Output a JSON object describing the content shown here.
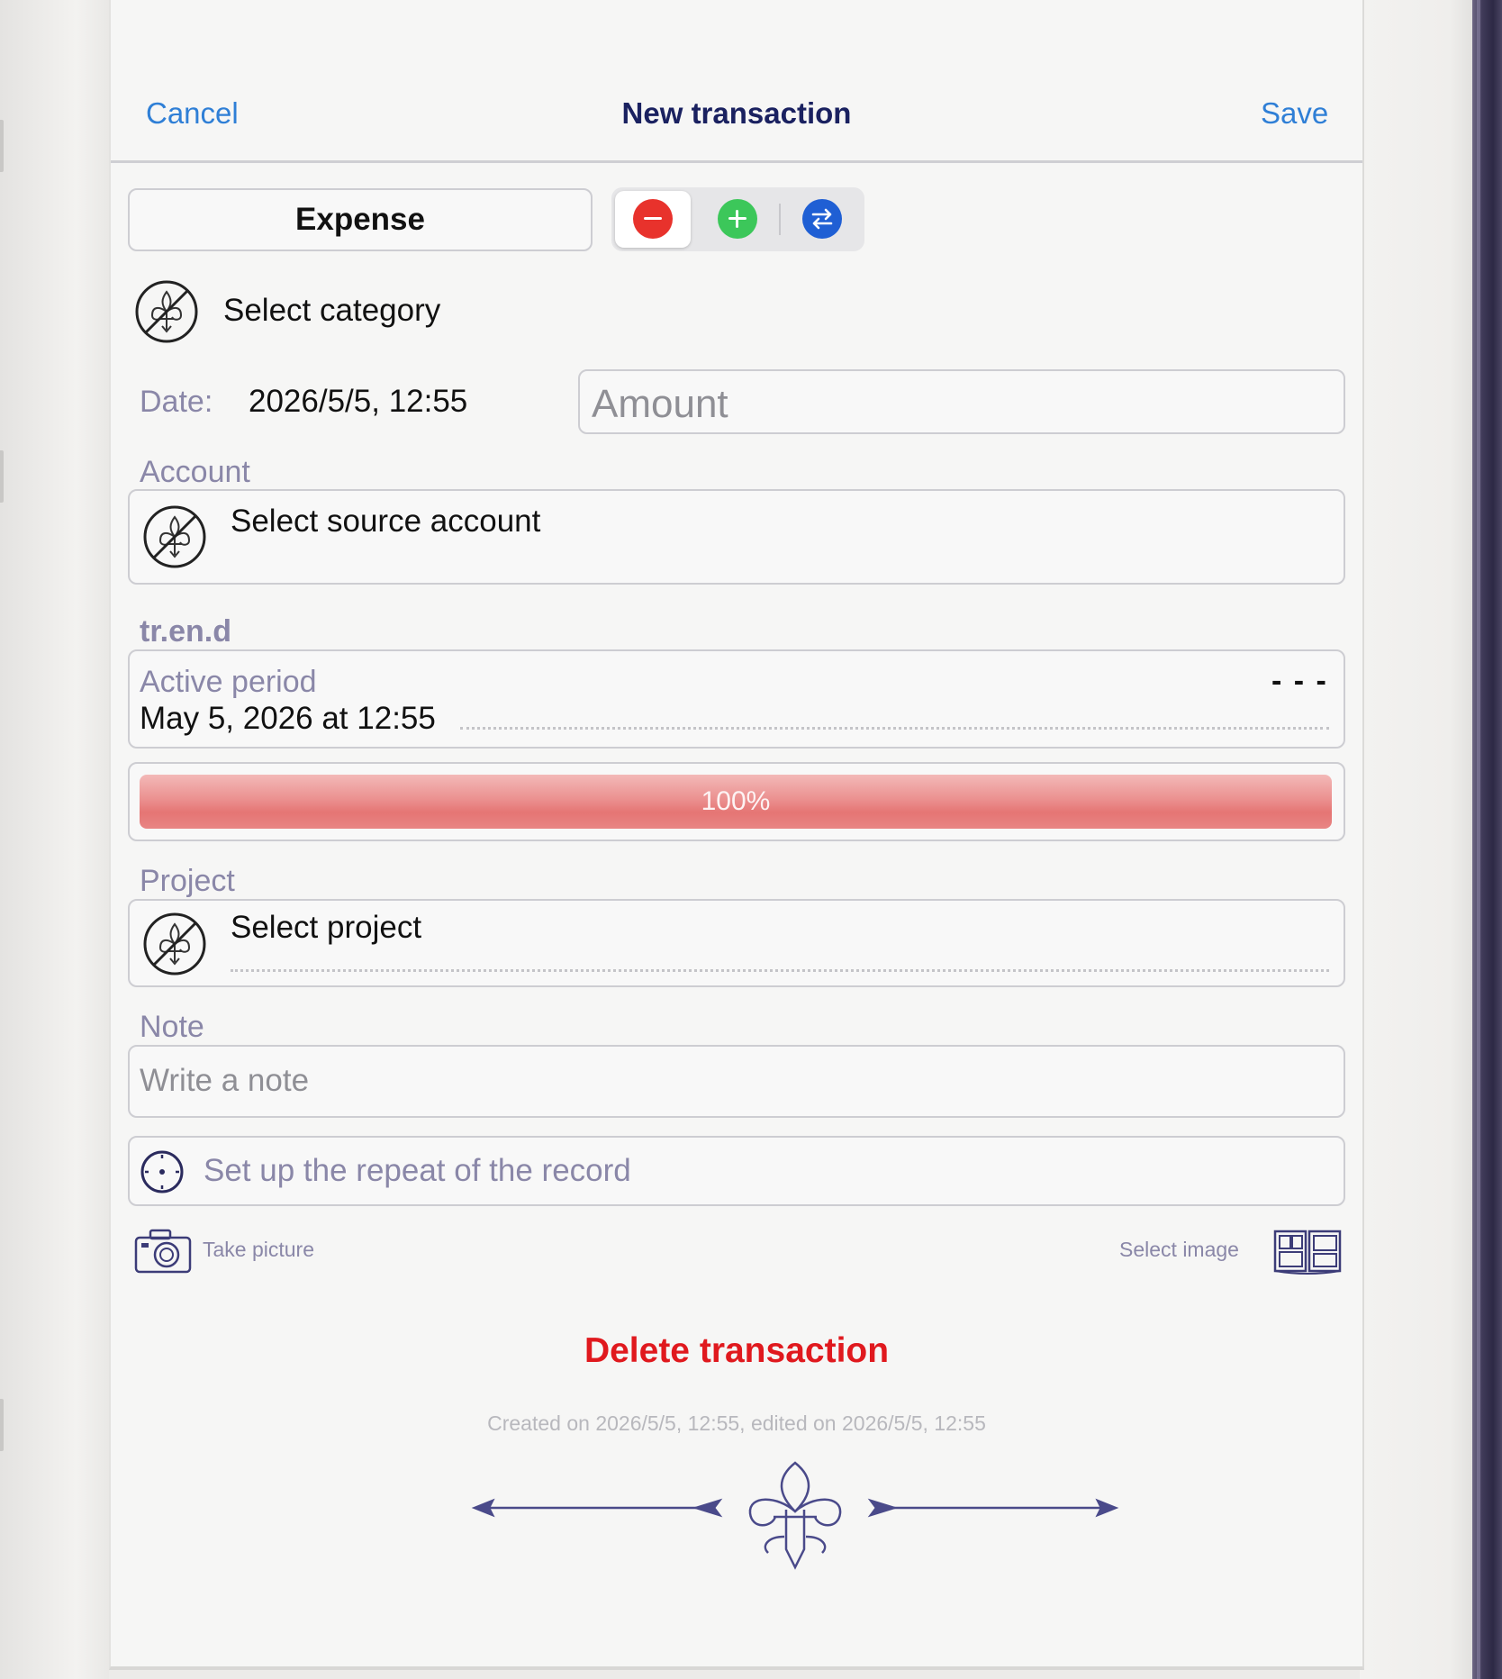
{
  "header": {
    "cancel_label": "Cancel",
    "title": "New transaction",
    "save_label": "Save"
  },
  "type_selector": {
    "selected_label": "Expense",
    "options": [
      "expense",
      "income",
      "transfer"
    ]
  },
  "category": {
    "placeholder": "Select category"
  },
  "date": {
    "label": "Date:",
    "value": "2026/5/5, 12:55"
  },
  "amount": {
    "placeholder": "Amount"
  },
  "account": {
    "label": "Account",
    "placeholder": "Select source account"
  },
  "trend": {
    "label": "tr.en.d",
    "active_period_label": "Active period",
    "active_period_value": "May 5, 2026 at 12:55",
    "end_value": "- - -"
  },
  "progress": {
    "value_percent": 100,
    "label": "100%"
  },
  "project": {
    "label": "Project",
    "placeholder": "Select project"
  },
  "note": {
    "label": "Note",
    "placeholder": "Write a note"
  },
  "repeat": {
    "label": "Set up the repeat of the record"
  },
  "media": {
    "take_picture_label": "Take picture",
    "select_image_label": "Select image"
  },
  "delete_label": "Delete transaction",
  "meta_text": "Created on 2026/5/5, 12:55, edited on 2026/5/5, 12:55",
  "colors": {
    "accent": "#2f7fd6",
    "title": "#1a2160",
    "label": "#8a87a8",
    "danger": "#e0191e",
    "expense": "#e8322c",
    "income": "#34c759",
    "transfer": "#1f5fd4",
    "ornament": "#4a4a8a"
  }
}
